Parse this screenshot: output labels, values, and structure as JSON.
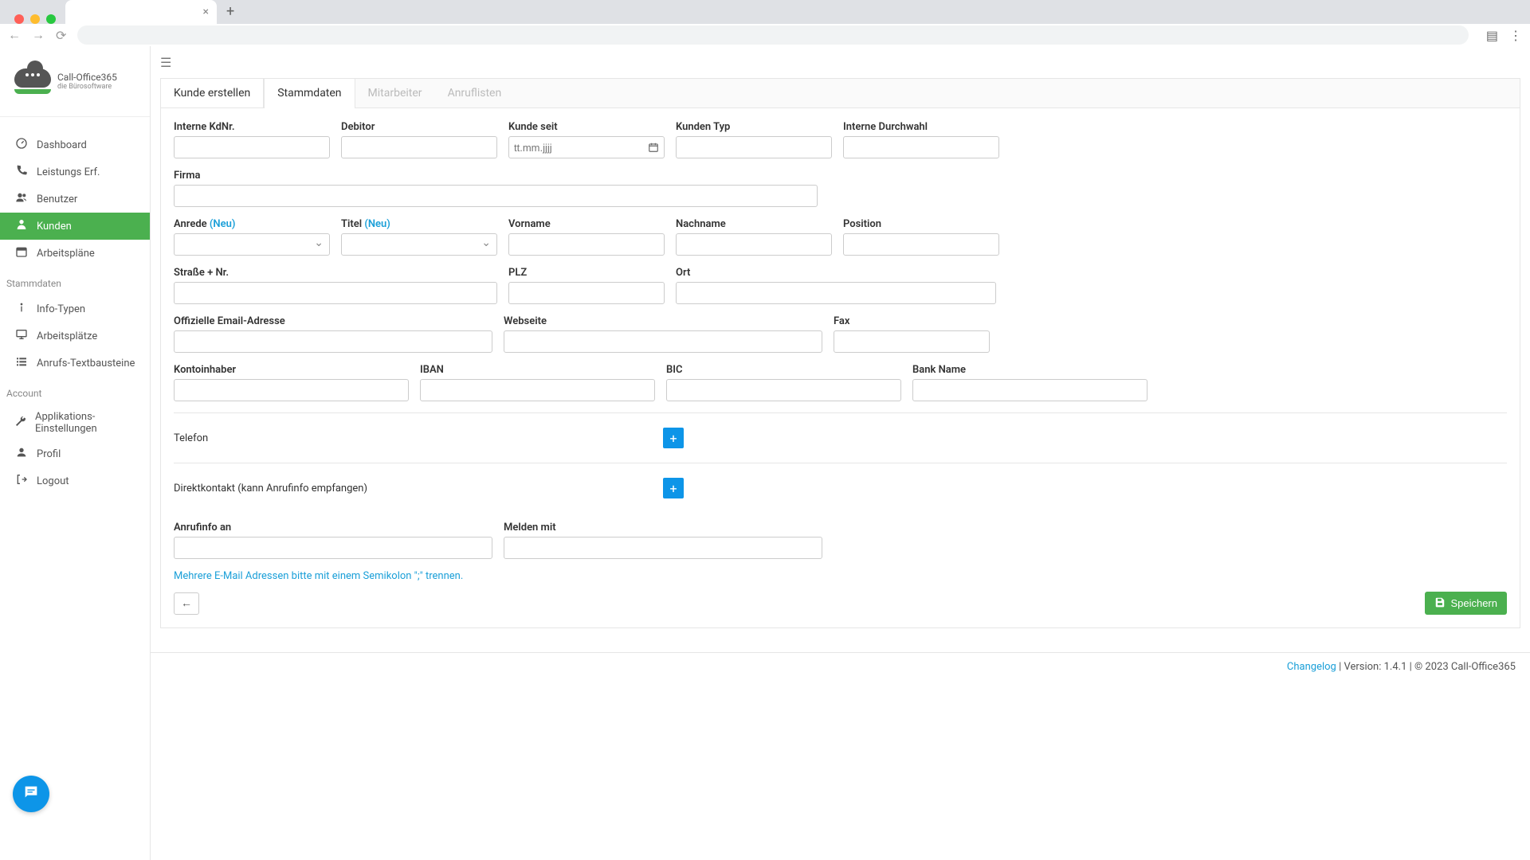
{
  "browser": {
    "tab_title": "",
    "new_tab": "+",
    "close_tab": "×"
  },
  "logo": {
    "title": "Call-Office365",
    "subtitle": "die Bürosoftware"
  },
  "sidebar": {
    "items": [
      {
        "label": "Dashboard"
      },
      {
        "label": "Leistungs Erf."
      },
      {
        "label": "Benutzer"
      },
      {
        "label": "Kunden"
      },
      {
        "label": "Arbeitspläne"
      }
    ],
    "section_stammdaten": "Stammdaten",
    "stammdaten_items": [
      {
        "label": "Info-Typen"
      },
      {
        "label": "Arbeitsplätze"
      },
      {
        "label": "Anrufs-Textbausteine"
      }
    ],
    "section_account": "Account",
    "account_items": [
      {
        "label": "Applikations-Einstellungen"
      },
      {
        "label": "Profil"
      },
      {
        "label": "Logout"
      }
    ]
  },
  "page": {
    "title": "Kunde erstellen",
    "tabs": [
      {
        "label": "Stammdaten"
      },
      {
        "label": "Mitarbeiter"
      },
      {
        "label": "Anruflisten"
      }
    ]
  },
  "form": {
    "interne_kdnr": "Interne KdNr.",
    "debitor": "Debitor",
    "kunde_seit": "Kunde seit",
    "kunde_seit_placeholder": "tt.mm.jjjj",
    "kunden_typ": "Kunden Typ",
    "interne_durchwahl": "Interne Durchwahl",
    "firma": "Firma",
    "anrede": "Anrede",
    "titel": "Titel",
    "neu": "(Neu)",
    "vorname": "Vorname",
    "nachname": "Nachname",
    "position": "Position",
    "strasse": "Straße + Nr.",
    "plz": "PLZ",
    "ort": "Ort",
    "email": "Offizielle Email-Adresse",
    "webseite": "Webseite",
    "fax": "Fax",
    "kontoinhaber": "Kontoinhaber",
    "iban": "IBAN",
    "bic": "BIC",
    "bank_name": "Bank Name",
    "telefon": "Telefon",
    "direktkontakt": "Direktkontakt (kann Anrufinfo empfangen)",
    "anrufinfo_an": "Anrufinfo an",
    "melden_mit": "Melden mit",
    "helper": "Mehrere E-Mail Adressen bitte mit einem Semikolon \";\" trennen.",
    "speichern": "Speichern"
  },
  "footer": {
    "changelog": "Changelog",
    "version_text": " | Version: 1.4.1 | © 2023 Call-Office365"
  }
}
